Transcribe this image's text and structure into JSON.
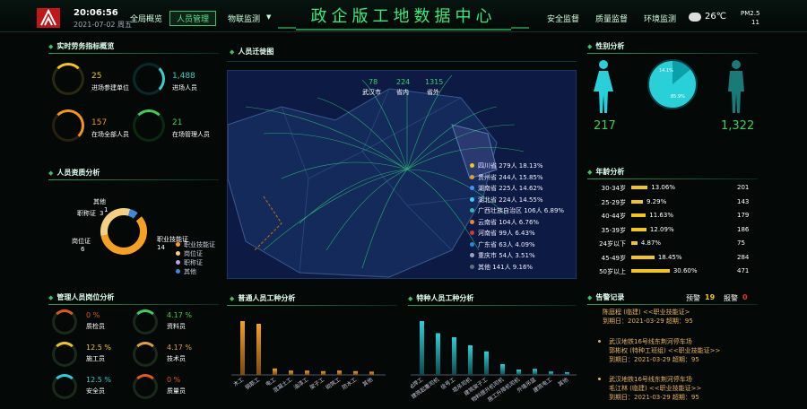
{
  "header": {
    "time": "20:06:56",
    "date": "2021-07-02 周五",
    "title": "政企版工地数据中心",
    "nav_left": [
      "全局概览",
      "人员管理",
      "物联监测"
    ],
    "nav_right": [
      "安全监督",
      "质量监督",
      "环境监测"
    ],
    "temp": "26℃",
    "pm_label": "PM2.5",
    "pm_value": "11"
  },
  "labor": {
    "title": "实时劳务指标概览",
    "stats": [
      {
        "value": "25",
        "label": "进场参建单位"
      },
      {
        "value": "1,488",
        "label": "进场人员"
      },
      {
        "value": "157",
        "label": "在场全部人员"
      },
      {
        "value": "21",
        "label": "在场管理人员"
      }
    ]
  },
  "qual": {
    "title": "人员资质分析",
    "items": [
      "其他",
      "职称证",
      "岗位证",
      "职业技能证"
    ],
    "counts": [
      "1",
      "3",
      "6",
      "14"
    ],
    "legend": [
      "职业技能证",
      "岗位证",
      "职称证",
      "其他"
    ]
  },
  "mgr": {
    "title": "管理人员岗位分析",
    "items": [
      {
        "pct": "0",
        "unit": "%",
        "label": "质检员"
      },
      {
        "pct": "4.17",
        "unit": "%",
        "label": "资料员"
      },
      {
        "pct": "12.5",
        "unit": "%",
        "label": "施工员"
      },
      {
        "pct": "4.17",
        "unit": "%",
        "label": "技术员"
      },
      {
        "pct": "12.5",
        "unit": "%",
        "label": "安全员"
      },
      {
        "pct": "0",
        "unit": "%",
        "label": "质量员"
      }
    ]
  },
  "migrate": {
    "title": "人员迁徙图",
    "top": [
      {
        "value": "78",
        "label": "武汉市"
      },
      {
        "value": "224",
        "label": "省内"
      },
      {
        "value": "1315",
        "label": "省外"
      }
    ],
    "legend": [
      {
        "name": "四川省",
        "count": "279人",
        "pct": "18.13%",
        "color": "#f5c518"
      },
      {
        "name": "贵州省",
        "count": "244人",
        "pct": "15.85%",
        "color": "#e8a020"
      },
      {
        "name": "湖南省",
        "count": "225人",
        "pct": "14.62%",
        "color": "#4c8ef7"
      },
      {
        "name": "湖北省",
        "count": "224人",
        "pct": "14.55%",
        "color": "#3ad0f0"
      },
      {
        "name": "广西壮族自治区",
        "count": "106人",
        "pct": "6.89%",
        "color": "#2fb7b0"
      },
      {
        "name": "云南省",
        "count": "104人",
        "pct": "6.76%",
        "color": "#f08a20"
      },
      {
        "name": "河南省",
        "count": "99人",
        "pct": "6.43%",
        "color": "#e03030"
      },
      {
        "name": "广东省",
        "count": "63人",
        "pct": "4.09%",
        "color": "#2a8ad0"
      },
      {
        "name": "重庆市",
        "count": "54人",
        "pct": "3.51%",
        "color": "#a0a0c0"
      },
      {
        "name": "其他",
        "count": "141人",
        "pct": "9.16%",
        "color": "#607080"
      }
    ]
  },
  "gender": {
    "title": "性别分析",
    "female": "217",
    "male": "1,322",
    "pct_female": "14.1%",
    "pct_male": "85.9%"
  },
  "age": {
    "title": "年龄分析",
    "rows": [
      {
        "label": "30-34岁",
        "pct": "13.06%",
        "n": "201",
        "v": 13.06
      },
      {
        "label": "25-29岁",
        "pct": "9.29%",
        "n": "143",
        "v": 9.29
      },
      {
        "label": "40-44岁",
        "pct": "11.63%",
        "n": "179",
        "v": 11.63
      },
      {
        "label": "35-39岁",
        "pct": "12.09%",
        "n": "186",
        "v": 12.09
      },
      {
        "label": "24岁以下",
        "pct": "4.87%",
        "n": "75",
        "v": 4.87
      },
      {
        "label": "45-49岁",
        "pct": "18.45%",
        "n": "284",
        "v": 18.45
      },
      {
        "label": "50岁以上",
        "pct": "30.60%",
        "n": "471",
        "v": 30.6
      }
    ]
  },
  "common": {
    "title": "普通人员工种分析",
    "cats": [
      "木工",
      "钢筋工",
      "电工",
      "混凝土工",
      "油漆工",
      "架子工",
      "砌筑工",
      "防水工",
      "其他"
    ],
    "values": [
      10,
      9.5,
      1.2,
      0.8,
      0.8,
      0.7,
      0.8,
      0.7,
      0.6
    ]
  },
  "special": {
    "title": "特种人员工种分析",
    "cats": [
      "电焊工",
      "建筑起重司机",
      "信号工",
      "塔吊司机",
      "建筑架子工",
      "物料提升机司机",
      "施工升降机司机",
      "外墙吊篮",
      "建筑电工",
      "其他"
    ],
    "values": [
      8,
      6.2,
      5.6,
      4.4,
      3.5,
      1.6,
      0.8,
      0.9,
      0.5,
      0.4
    ]
  },
  "alarms": {
    "title": "告警记录",
    "warn_label": "预警",
    "warn_count": "19",
    "alarm_label": "报警",
    "alarm_count": "0",
    "items": [
      {
        "l1": "陈庭程 (临建) <<职业技能证>",
        "l2": "到期日：2021-03-29 超期：95"
      },
      {
        "l1": "武汉地铁16号线东荆河停车场",
        "l2": "郭彬权 (特种工班组) <<职业技能证>>",
        "l3": "到期日：2021-03-29 超期：95"
      },
      {
        "l1": "武汉地铁16号线东荆河停车场",
        "l2": "毛江林 (临建) <<职业技能证>>",
        "l3": "到期日：2021-03-29 超期：95"
      }
    ]
  }
}
